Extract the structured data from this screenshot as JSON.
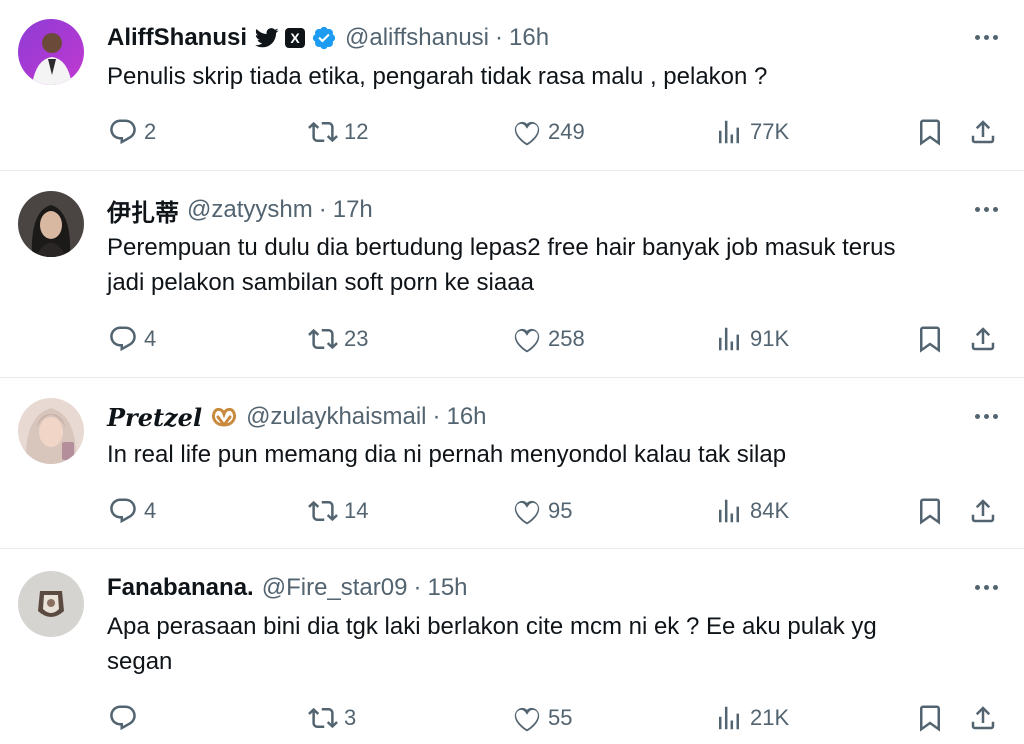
{
  "tweets": [
    {
      "name": "AliffShanusi",
      "handle": "@aliffshanusi",
      "dot": "·",
      "time": "16h",
      "text": "Penulis skrip tiada etika, pengarah tidak rasa malu , pelakon ?",
      "replies": "2",
      "retweets": "12",
      "likes": "249",
      "views": "77K",
      "badges": [
        "bird-icon",
        "x-badge-icon",
        "verified-icon"
      ]
    },
    {
      "name": "伊扎蒂",
      "handle": "@zatyyshm",
      "dot": "·",
      "time": "17h",
      "text": "Perempuan tu dulu dia bertudung lepas2 free hair banyak job masuk terus\njadi pelakon sambilan soft porn ke siaaa",
      "replies": "4",
      "retweets": "23",
      "likes": "258",
      "views": "91K"
    },
    {
      "name": "Pretzel",
      "handle": "@zulaykhaismail",
      "dot": "·",
      "time": "16h",
      "text": "In real life pun memang dia ni pernah menyondol kalau tak silap",
      "replies": "4",
      "retweets": "14",
      "likes": "95",
      "views": "84K",
      "badges": [
        "pretzel-icon"
      ]
    },
    {
      "name": "Fanabanana.",
      "handle": "@Fire_star09",
      "dot": "·",
      "time": "15h",
      "text": "Apa perasaan bini dia tgk laki berlakon cite mcm ni ek ? Ee aku pulak yg\nsegan",
      "replies": "",
      "retweets": "3",
      "likes": "55",
      "views": "21K"
    }
  ],
  "colors": {
    "text": "#0f1419",
    "secondary": "#536471",
    "verified": "#1d9bf0",
    "divider": "#e6eaed"
  },
  "badge_x_label": "X"
}
